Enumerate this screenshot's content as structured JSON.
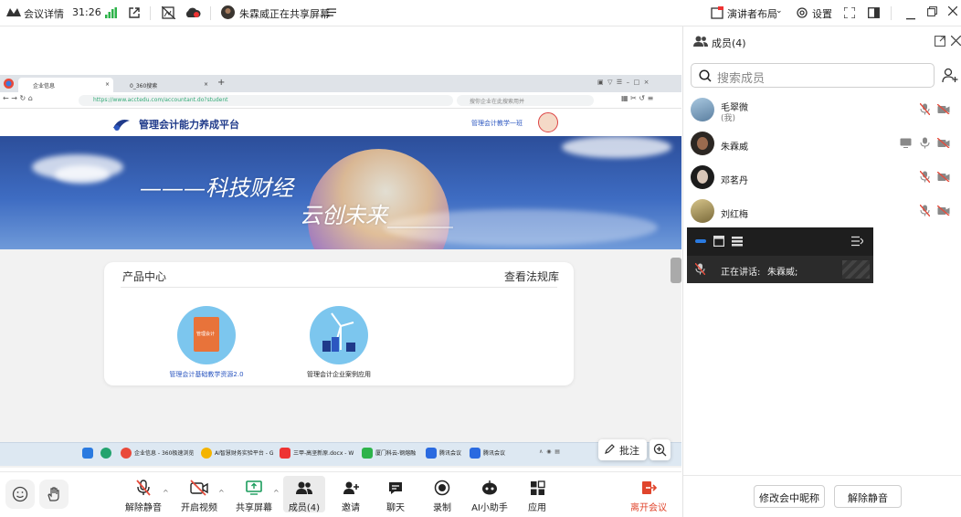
{
  "topbar": {
    "meeting_info": "会议详情",
    "timer": "31:26",
    "sharing_status": "朱霖威正在共享屏幕",
    "presenter_layout": "演讲者布局",
    "settings": "设置"
  },
  "shared_screen": {
    "browser_tabs": [
      "企业信息",
      "0_360搜索"
    ],
    "url": "https://www.acctedu.com/accountant.do?student",
    "search_placeholder": "搜你企业在此搜索用并",
    "site_title": "管理会计能力养成平台",
    "site_user": "管理会计教学一班",
    "slogan_1": "———科技财经",
    "slogan_2": "云创未来______",
    "product_center": "产品中心",
    "view_regulations": "查看法规库",
    "products": [
      {
        "label": "管理会计基础教学资源2.0",
        "icon_text": "管理会计"
      },
      {
        "label": "管理会计企业案例应用"
      }
    ],
    "taskbar_items": [
      "企业信息 - 360极速浏览",
      "AI智慧财务实验平台 - G",
      "三甲-高坚新原.docx - W",
      "厦门科云-钢熔融",
      "腾讯会议",
      "腾讯会议"
    ],
    "annotate": "批注"
  },
  "toolbar": {
    "unmute": "解除静音",
    "start_video": "开启视频",
    "share_screen": "共享屏幕",
    "members": "成员(4)",
    "invite": "邀请",
    "chat": "聊天",
    "record": "录制",
    "ai_assistant": "AI小助手",
    "apps": "应用",
    "leave": "离开会议"
  },
  "panel": {
    "title": "成员(4)",
    "search_placeholder": "搜索成员",
    "members": [
      {
        "name": "毛翠微",
        "sub": "(我)"
      },
      {
        "name": "朱霖威"
      },
      {
        "name": "邓茗丹"
      },
      {
        "name": "刘红梅"
      }
    ],
    "speaking_label": "正在讲话:",
    "speaking_name": "朱霖威;",
    "rename_button": "修改会中昵称",
    "unmute_all_button": "解除静音"
  },
  "colors": {
    "accent": "#2a6ae0",
    "leave_red": "#e0452c",
    "mute_red": "#e64c3c"
  }
}
